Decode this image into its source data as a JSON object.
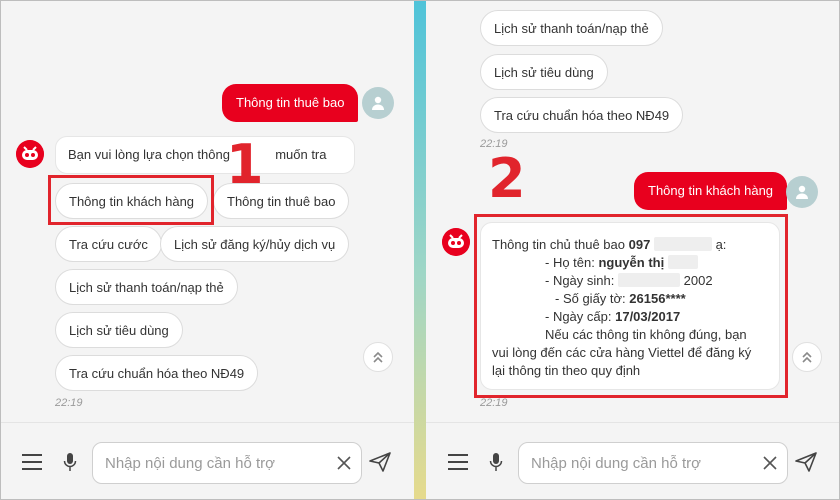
{
  "left": {
    "user_message": "Thông tin thuê bao",
    "bot_prompt": {
      "before": "Bạn vui lòng lựa chọn thông",
      "after": "muốn tra cứu:"
    },
    "options": [
      "Thông tin khách hàng",
      "Thông tin thuê bao",
      "Tra cứu cước",
      "Lịch sử đăng ký/hủy dịch vụ",
      "Lịch sử thanh toán/nạp thẻ",
      "Lịch sử tiêu dùng",
      "Tra cứu chuẩn hóa theo NĐ49"
    ],
    "timestamp": "22:19",
    "step_label": "1"
  },
  "right": {
    "options": [
      "Lịch sử thanh toán/nạp thẻ",
      "Lịch sử tiêu dùng",
      "Tra cứu chuẩn hóa theo NĐ49"
    ],
    "timestamp_top": "22:19",
    "step_label": "2",
    "user_message": "Thông tin khách hàng",
    "info": {
      "header_prefix": "Thông tin chủ thuê bao",
      "phone_prefix": "097",
      "header_suffix": "ạ:",
      "name_label": "- Họ tên:",
      "name_value": "nguyễn thị",
      "dob_label": "- Ngày sinh:",
      "dob_value": "2002",
      "id_label": "- Số giấy tờ:",
      "id_value": "26156****",
      "issue_label": "- Ngày cấp:",
      "issue_value": "17/03/2017",
      "note_line1": "Nếu các thông tin không đúng, bạn",
      "note_line2": "vui lòng đến các cửa hàng Viettel để đăng ký",
      "note_line3": "lại thông tin theo quy định"
    },
    "timestamp_bottom": "22:19"
  },
  "input": {
    "placeholder": "Nhập nội dung cần hỗ trợ"
  },
  "icons": {
    "menu": "menu-icon",
    "mic": "microphone-icon",
    "clear": "close-icon",
    "send": "send-icon",
    "scroll": "chevron-double-up-icon",
    "user": "user-icon",
    "bot": "bot-mascot-icon"
  },
  "colors": {
    "brand_red": "#e8001e",
    "highlight": "#e1242c",
    "avatar_bg": "#b7cfd1"
  }
}
